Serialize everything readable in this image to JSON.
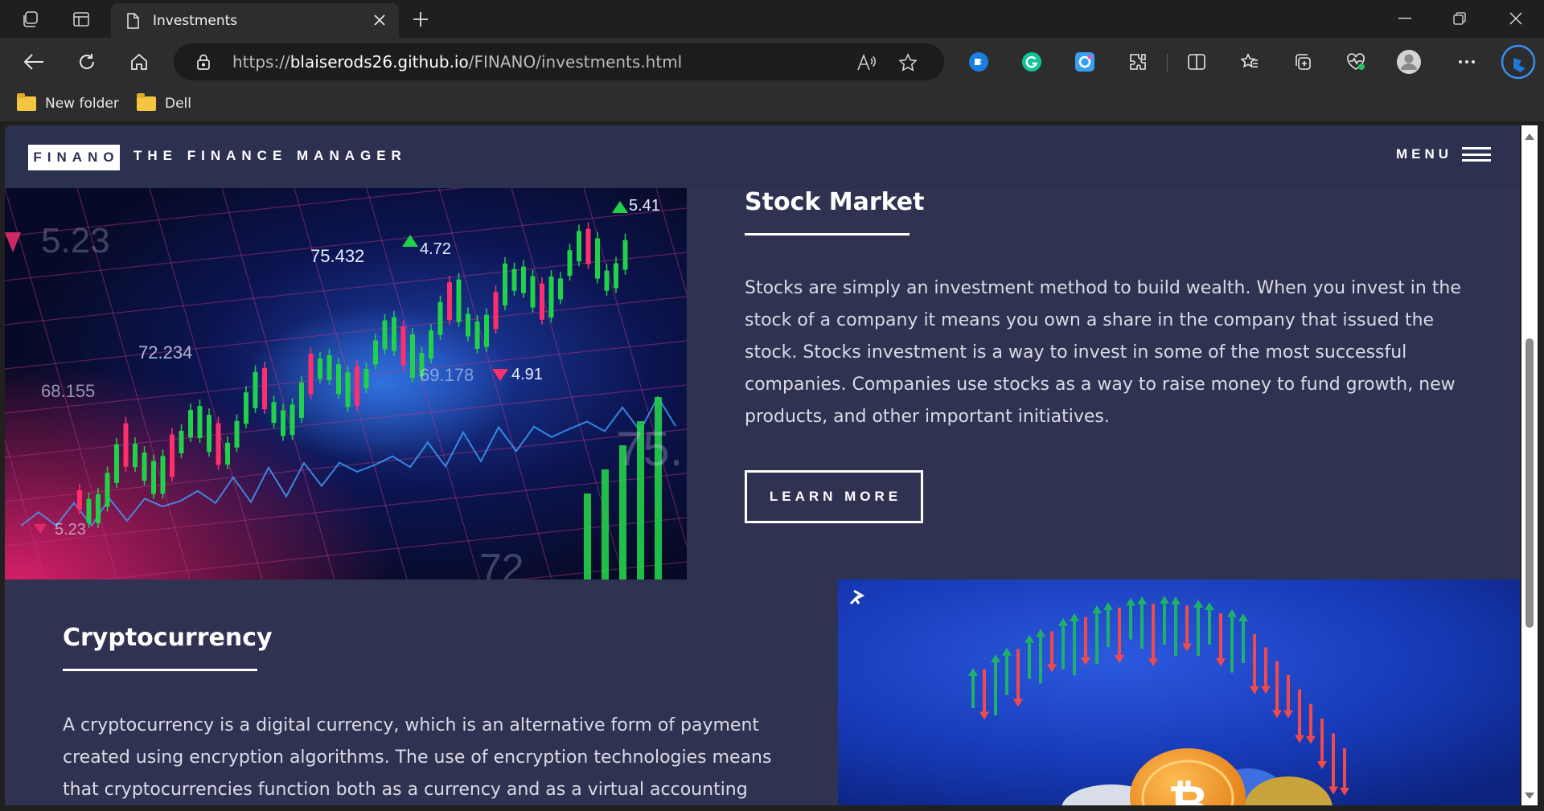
{
  "browser": {
    "tab_title": "Investments",
    "url_prefix": "https://",
    "url_host": "blaiserods26.github.io",
    "url_path": "/FINANO/investments.html",
    "bookmarks": [
      {
        "label": "New folder"
      },
      {
        "label": "Dell"
      }
    ],
    "extension_icons": [
      "vpn-icon",
      "grammarly-icon",
      "screen-capture-icon",
      "extensions-icon",
      "split-screen-icon",
      "favorites-icon",
      "collections-icon",
      "browser-essentials-icon",
      "profile-icon",
      "more-icon",
      "copilot-icon"
    ]
  },
  "site": {
    "logo": "FINANO",
    "tagline": "THE FINANCE MANAGER",
    "menu_label": "MENU"
  },
  "stock": {
    "title": "Stock Market",
    "body": "Stocks are simply an investment method to build wealth. When you invest in the stock of a company it means you own a share in the company that issued the stock. Stocks investment is a way to invest in some of the most successful companies. Companies use stocks as a way to raise money to fund growth, new products, and other important initiatives.",
    "button": "LEARN MORE",
    "image_labels": [
      "5.23",
      "75.432",
      "4.72",
      "5.41",
      "72.234",
      "68.155",
      "69.178",
      "4.91",
      "5.23",
      "75.",
      "72"
    ]
  },
  "crypto": {
    "title": "Cryptocurrency",
    "body": "A cryptocurrency is a digital currency, which is an alternative form of payment created using encryption algorithms. The use of encryption technologies means that cryptocurrencies function both as a currency and as a virtual accounting system."
  },
  "colors": {
    "page_bg": "#2f3351",
    "header_bg": "#2d3150",
    "text_muted": "#d9dbe6",
    "up_green": "#22d14a",
    "down_red": "#ff2f6e",
    "crypto_blue": "#1f47c9"
  }
}
